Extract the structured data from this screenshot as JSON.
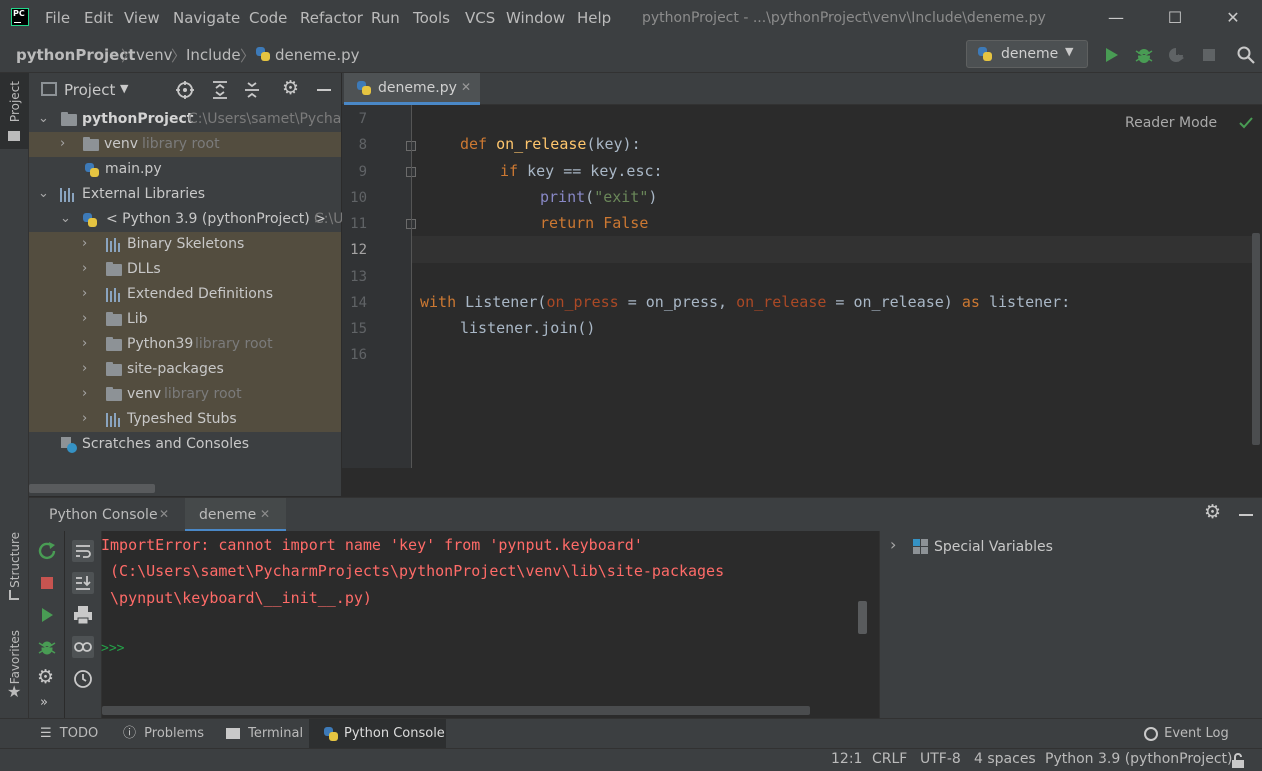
{
  "titlebar": {
    "menu": [
      "File",
      "Edit",
      "View",
      "Navigate",
      "Code",
      "Refactor",
      "Run",
      "Tools",
      "VCS",
      "Window",
      "Help"
    ],
    "window_title": "pythonProject - ...\\pythonProject\\venv\\Include\\deneme.py",
    "logo_text": "PC"
  },
  "navbar": {
    "breadcrumbs": [
      "pythonProject",
      "venv",
      "Include",
      "deneme.py"
    ],
    "run_config": "deneme"
  },
  "left_strip": {
    "project": "Project",
    "structure": "Structure",
    "favorites": "Favorites"
  },
  "project_panel": {
    "title": "Project",
    "root_name": "pythonProject",
    "root_path": "C:\\Users\\samet\\Pycharm",
    "venv": "venv",
    "library_root": "library root",
    "main": "main.py",
    "external": "External Libraries",
    "python_sdk": "< Python 3.9 (pythonProject) >",
    "python_sdk_path": "C:\\U",
    "items": [
      "Binary Skeletons",
      "DLLs",
      "Extended Definitions",
      "Lib",
      "Python39",
      "site-packages",
      "venv",
      "Typeshed Stubs"
    ],
    "scratches": "Scratches and Consoles"
  },
  "editor": {
    "tab": "deneme.py",
    "reader_mode": "Reader Mode",
    "line_numbers": [
      "7",
      "8",
      "9",
      "10",
      "11",
      "12",
      "13",
      "14",
      "15",
      "16"
    ],
    "code": {
      "l8_def": "def",
      "l8_fn": "on_release",
      "l8_rest": "(key):",
      "l9_if": "if",
      "l9_rest": " key == key.esc:",
      "l10_print": "print",
      "l10_open": "(",
      "l10_str": "\"exit\"",
      "l10_close": ")",
      "l11_return": "return",
      "l11_false": "False",
      "l14_with": "with",
      "l14_a": " Listener(",
      "l14_p1": "on_press",
      "l14_b": " = on_press, ",
      "l14_p2": "on_release",
      "l14_c": " = on_release) ",
      "l14_as": "as",
      "l14_d": " listener:",
      "l15": "listener.join()"
    }
  },
  "bottom_panel": {
    "tabs": [
      "Python Console",
      "deneme"
    ],
    "error_lines": [
      "ImportError: cannot import name 'key' from 'pynput.keyboard'",
      " (C:\\Users\\samet\\PycharmProjects\\pythonProject\\venv\\lib\\site-packages",
      " \\pynput\\keyboard\\__init__.py)"
    ],
    "prompt": ">>>",
    "special_variables": "Special Variables"
  },
  "bottom_strip": {
    "todo": "TODO",
    "problems": "Problems",
    "terminal": "Terminal",
    "python_console": "Python Console",
    "event_log": "Event Log"
  },
  "statusbar": {
    "position": "12:1",
    "line_sep": "CRLF",
    "encoding": "UTF-8",
    "indent": "4 spaces",
    "interpreter": "Python 3.9 (pythonProject)"
  },
  "colors": {
    "accent": "#4a88c7",
    "error": "#ff6b68",
    "keyword": "#cc7832",
    "function": "#ffc66d",
    "string": "#6a8759",
    "run_green": "#499c54"
  }
}
